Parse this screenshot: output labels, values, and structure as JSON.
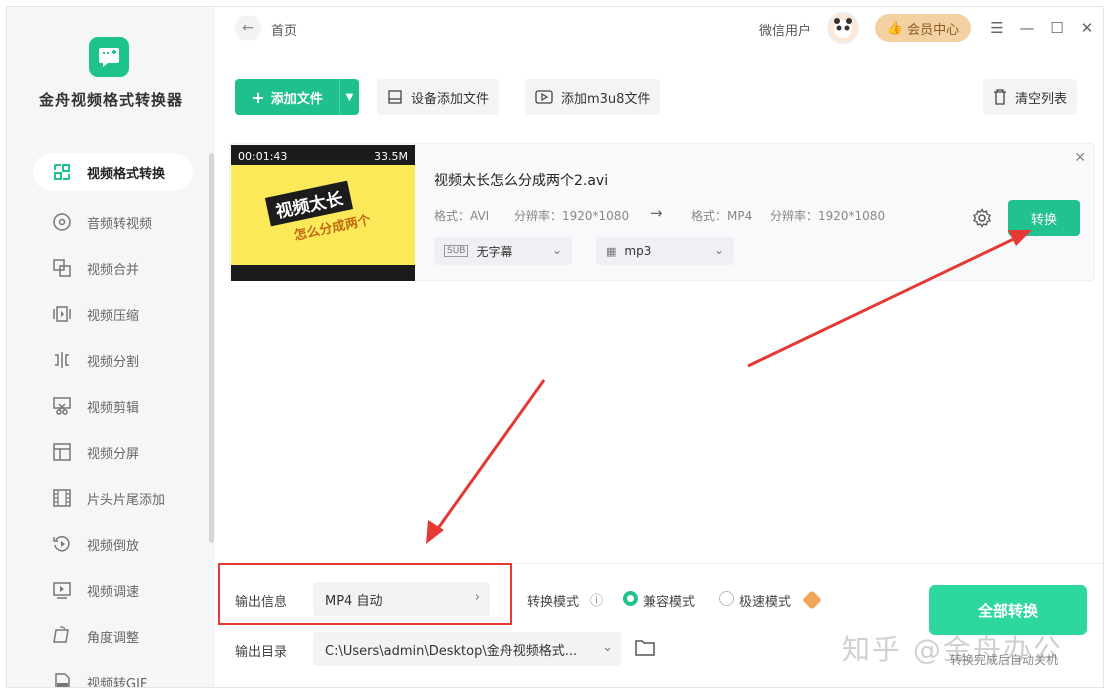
{
  "app": {
    "title": "金舟视频格式转换器"
  },
  "sidebar": {
    "items": [
      {
        "label": "视频格式转换",
        "icon": "convert-icon",
        "active": true
      },
      {
        "label": "音频转视频",
        "icon": "music-disc-icon"
      },
      {
        "label": "视频合并",
        "icon": "merge-icon"
      },
      {
        "label": "视频压缩",
        "icon": "compress-icon"
      },
      {
        "label": "视频分割",
        "icon": "split-icon"
      },
      {
        "label": "视频剪辑",
        "icon": "scissors-icon"
      },
      {
        "label": "视频分屏",
        "icon": "layout-icon"
      },
      {
        "label": "片头片尾添加",
        "icon": "film-icon"
      },
      {
        "label": "视频倒放",
        "icon": "rewind-icon"
      },
      {
        "label": "视频调速",
        "icon": "speed-icon"
      },
      {
        "label": "角度调整",
        "icon": "rotate-icon"
      },
      {
        "label": "视频转GIF",
        "icon": "gif-icon"
      }
    ]
  },
  "topbar": {
    "breadcrumb": "首页",
    "user_name": "微信用户",
    "vip_label": "会员中心"
  },
  "toolbar": {
    "add_file": "添加文件",
    "device_add": "设备添加文件",
    "add_m3u8": "添加m3u8文件",
    "clear_list": "清空列表"
  },
  "file": {
    "thumb_time": "00:01:43",
    "thumb_size": "33.5M",
    "thumb_title": "视频太长",
    "thumb_subtitle": "怎么分成两个",
    "name": "视频太长怎么分成两个2.avi",
    "src_format": "格式：AVI",
    "src_resolution": "分辨率：1920*1080",
    "dst_format": "格式：MP4",
    "dst_resolution": "分辨率：1920*1080",
    "subtitle_option": "无字幕",
    "audio_option": "mp3",
    "convert_label": "转换"
  },
  "bottom": {
    "output_info_label": "输出信息",
    "output_format": "MP4 自动",
    "mode_label": "转换模式",
    "mode_compat": "兼容模式",
    "mode_fast": "极速模式",
    "output_dir_label": "输出目录",
    "output_dir": "C:\\Users\\admin\\Desktop\\金舟视频格式...",
    "convert_all": "全部转换",
    "auto_close": "转换完成后自动关机"
  },
  "watermark": "知乎 @金舟办公",
  "colors": {
    "accent": "#21c28f",
    "vip": "#f3d1a3",
    "annotation": "#e53935"
  }
}
